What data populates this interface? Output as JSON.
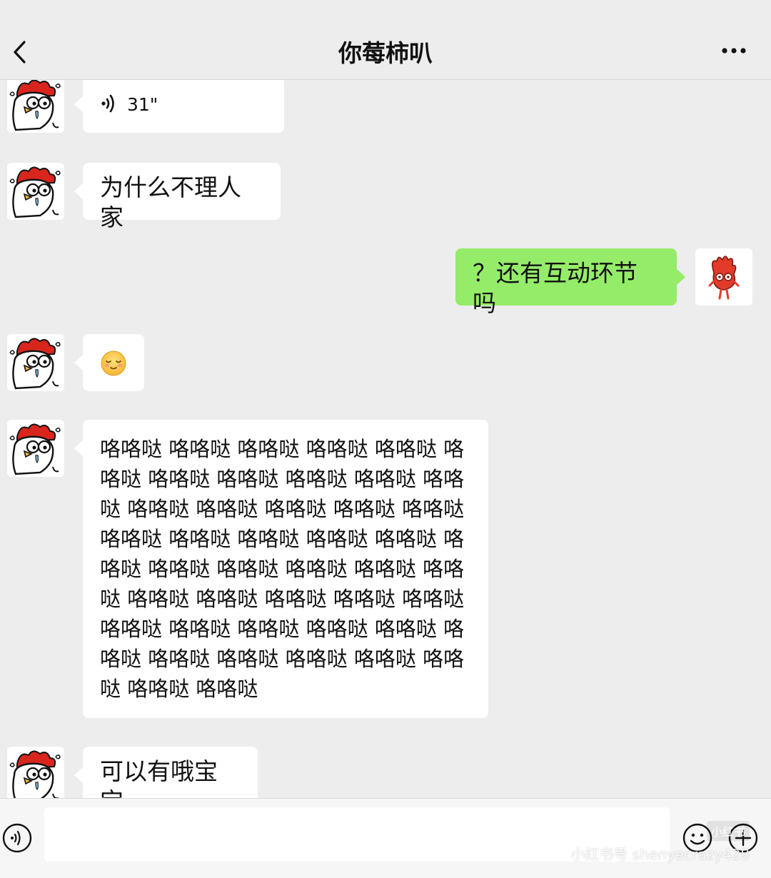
{
  "header": {
    "title": "你莓柿叭",
    "top_dots": "•••"
  },
  "messages": [
    {
      "sender": "other",
      "type": "voice",
      "duration": "31\""
    },
    {
      "sender": "other",
      "type": "text",
      "text": "为什么不理人家"
    },
    {
      "sender": "me",
      "type": "text",
      "text": "？还有互动环节吗"
    },
    {
      "sender": "other",
      "type": "emoji",
      "emoji": "blush-emoji"
    },
    {
      "sender": "other",
      "type": "text",
      "text": "咯咯哒 咯咯哒 咯咯哒 咯咯哒 咯咯哒 咯咯哒 咯咯哒 咯咯哒 咯咯哒 咯咯哒 咯咯哒 咯咯哒 咯咯哒 咯咯哒 咯咯哒 咯咯哒 咯咯哒 咯咯哒 咯咯哒 咯咯哒 咯咯哒 咯咯哒 咯咯哒 咯咯哒 咯咯哒 咯咯哒 咯咯哒 咯咯哒 咯咯哒 咯咯哒 咯咯哒 咯咯哒 咯咯哒 咯咯哒 咯咯哒 咯咯哒 咯咯哒 咯咯哒 咯咯哒 咯咯哒 咯咯哒 咯咯哒 咯咯哒 咯咯哒 咯咯哒"
    },
    {
      "sender": "other",
      "type": "text",
      "text": "可以有哦宝宝"
    }
  ],
  "input": {
    "value": "",
    "placeholder": ""
  },
  "watermark": {
    "text": "小红书号 shenyecrazy428",
    "logo": "小红书"
  },
  "colors": {
    "background": "#ededed",
    "bubble_other": "#ffffff",
    "bubble_me": "#95ec69"
  }
}
